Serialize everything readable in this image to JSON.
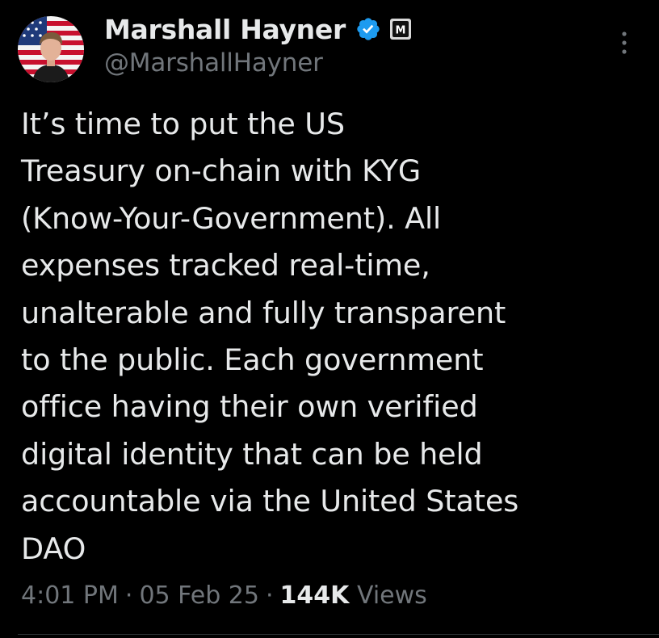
{
  "author": {
    "display_name": "Marshall Hayner",
    "handle": "@MarshallHayner",
    "avatar_icon": "profile-photo-flag-background",
    "verified_icon": "verified-badge-icon",
    "affiliate_badge_icon": "affiliate-badge-icon",
    "affiliate_badge_letter": "M"
  },
  "tweet": {
    "text": "It’s time to put the US\nTreasury on-chain with KYG\n(Know-Your-Government). All\nexpenses tracked real-time,\nunalterable and fully transparent\nto the public. Each government\noffice having their own verified\ndigital identity that can be held\naccountable via the United States\nDAO"
  },
  "meta": {
    "time": "4:01 PM",
    "separator": "·",
    "date": "05 Feb 25",
    "views_count": "144K",
    "views_label": "Views"
  },
  "colors": {
    "background": "#000000",
    "primary_text": "#e7e9ea",
    "secondary_text": "#71767b",
    "verified_blue": "#1d9bf0",
    "divider": "#2f3336"
  }
}
